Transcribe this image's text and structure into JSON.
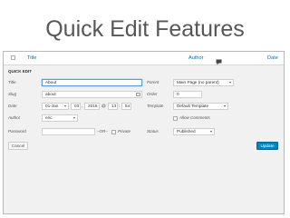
{
  "slide": {
    "title": "Quick Edit Features"
  },
  "list_header": {
    "title": "Title",
    "author": "Author",
    "date": "Date"
  },
  "quick_edit": {
    "heading": "QUICK EDIT",
    "left": {
      "title_label": "Title",
      "title_value": "About",
      "slug_label": "Slug",
      "slug_value": "about",
      "date_label": "Date",
      "date_month": "01-Jan",
      "date_day": "03",
      "date_year": "2016",
      "at": "@",
      "date_hour": "13",
      "date_sep": ":",
      "date_minute": "54",
      "author_label": "Author",
      "author_value": "eric",
      "password_label": "Password",
      "password_value": "",
      "or": "–OR–",
      "private_label": "Private"
    },
    "right": {
      "parent_label": "Parent",
      "parent_value": "Main Page (no parent)",
      "order_label": "Order",
      "order_value": "0",
      "template_label": "Template",
      "template_value": "Default Template",
      "allow_comments": "Allow Comments",
      "status_label": "Status",
      "status_value": "Published"
    },
    "cancel_label": "Cancel",
    "update_label": "Update"
  }
}
